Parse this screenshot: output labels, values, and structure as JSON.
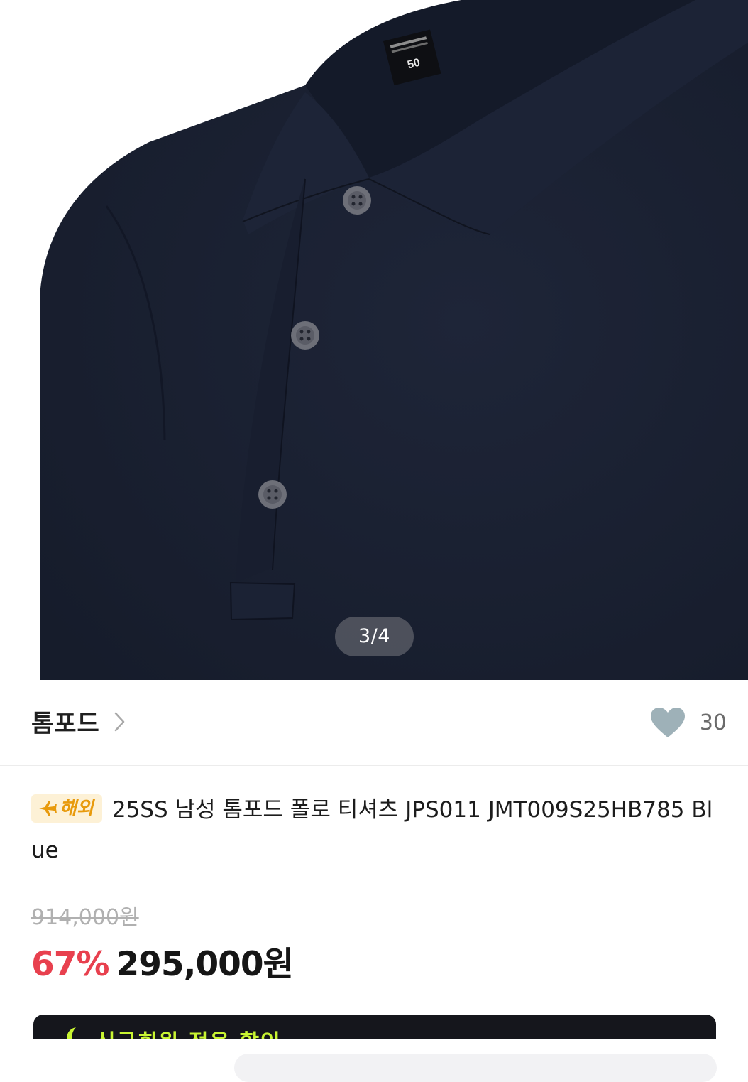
{
  "gallery": {
    "page_indicator": "3/4",
    "label_size": "50"
  },
  "brand": {
    "name": "톰포드",
    "chevron_icon": "chevron-right-icon",
    "like_icon": "heart-icon",
    "like_count": "30"
  },
  "product": {
    "badge": "해외",
    "badge_icon": "airplane-icon",
    "title": "25SS 남성 톰포드 폴로 티셔츠 JPS011 JMT009S25HB785 Blue"
  },
  "price": {
    "original": "914,000원",
    "discount_rate": "67%",
    "sale": "295,000원"
  },
  "promo": {
    "text": "신규회원 적용 할인",
    "icon": "moon-icon"
  },
  "colors": {
    "discount": "#e8404e",
    "badge_text": "#e89a0c",
    "badge_bg": "#fdf1d6",
    "promo_bg": "#15161c",
    "promo_text": "#c9f532",
    "shirt": "#1b2234"
  }
}
